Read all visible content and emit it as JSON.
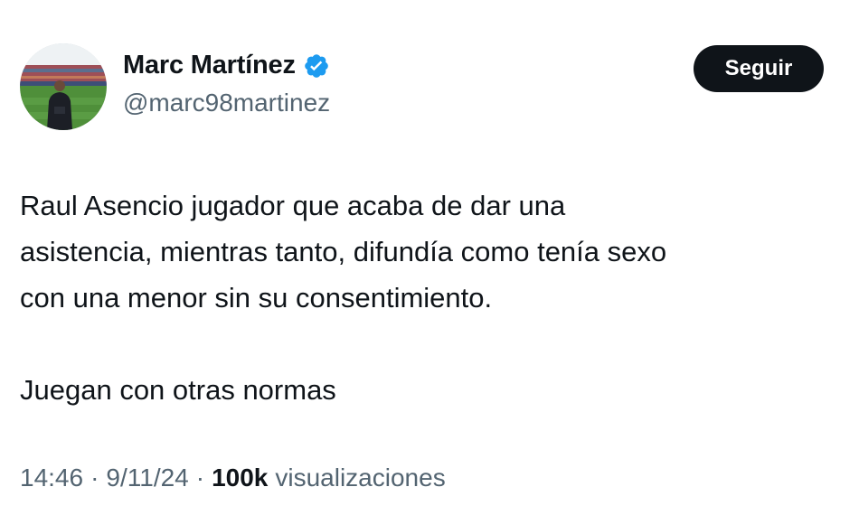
{
  "author": {
    "display_name": "Marc Martínez",
    "handle": "@marc98martinez",
    "verified": true,
    "verified_color": "#1d9bf0",
    "avatar": "profile-photo-stadium"
  },
  "follow_button": {
    "label": "Seguir",
    "bg_color": "#0f1419",
    "text_color": "#ffffff"
  },
  "tweet": {
    "paragraph_1": "Raul Asencio jugador que acaba de dar una\nasistencia, mientras tanto, difundía como tenía sexo\ncon una menor sin su consentimiento.",
    "paragraph_2": "Juegan con otras normas"
  },
  "meta": {
    "time": "14:46",
    "separator": "·",
    "date": "9/11/24",
    "views_count": "100k",
    "views_label": "visualizaciones"
  },
  "colors": {
    "text_primary": "#0f1419",
    "text_secondary": "#536471"
  }
}
